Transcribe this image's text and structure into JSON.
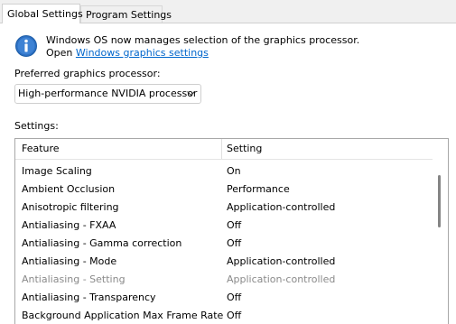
{
  "tabs": [
    {
      "label": "Global Settings"
    },
    {
      "label": "Program Settings"
    }
  ],
  "info": {
    "line1": "Windows OS now manages selection of the graphics processor.",
    "line2_prefix": "Open ",
    "link_text": "Windows graphics settings"
  },
  "preferred": {
    "label": "Preferred graphics processor:",
    "selected": "High-performance NVIDIA processor"
  },
  "settings": {
    "label": "Settings:",
    "columns": {
      "feature": "Feature",
      "setting": "Setting"
    },
    "rows": [
      {
        "feature": "Image Scaling",
        "setting": "On"
      },
      {
        "feature": "Ambient Occlusion",
        "setting": "Performance"
      },
      {
        "feature": "Anisotropic filtering",
        "setting": "Application-controlled"
      },
      {
        "feature": "Antialiasing - FXAA",
        "setting": "Off"
      },
      {
        "feature": "Antialiasing - Gamma correction",
        "setting": "Off"
      },
      {
        "feature": "Antialiasing - Mode",
        "setting": "Application-controlled"
      },
      {
        "feature": "Antialiasing - Setting",
        "setting": "Application-controlled"
      },
      {
        "feature": "Antialiasing - Transparency",
        "setting": "Off"
      },
      {
        "feature": "Background Application Max Frame Rate",
        "setting": "Off"
      }
    ]
  },
  "colors": {
    "link": "#0066cc",
    "disabled_text": "#8a8a8a",
    "info_icon": "#1f5fa8"
  }
}
